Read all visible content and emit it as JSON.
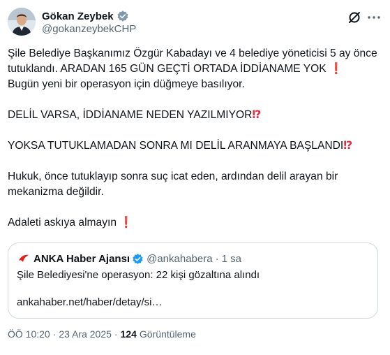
{
  "author": {
    "display_name": "Gökan Zeybek",
    "handle": "@gokanzeybekCHP",
    "verified_color": "#829aab"
  },
  "icons": {
    "grok": "grok-icon",
    "more": "more-options-icon"
  },
  "tweet": {
    "paragraphs": [
      "Şile Belediye Başkanımız Özgür Kabadayı ve 4 belediye yöneticisi 5 ay önce tutuklandı. ARADAN 165 GÜN GEÇTİ ORTADA İDDİANAME YOK",
      "Bugün yeni bir operasyon için düğmeye basılıyor.",
      "DELİL VARSA, İDDİANAME NEDEN YAZILMIYOR",
      "YOKSA TUTUKLAMADAN SONRA MI DELİL ARANMAYA BAŞLANDI",
      "Hukuk, önce tutuklayıp sonra suç icat eden, ardından delil arayan bir mekanizma değildir.",
      "Adaleti askıya almayın"
    ],
    "emoji_exclamation": "❗",
    "emoji_interrobang": "⁉"
  },
  "quote": {
    "name": "ANKA Haber Ajansı",
    "handle": "@ankahabera",
    "dot": "·",
    "time": "1 sa",
    "text": "Şile Belediyesi'ne operasyon: 22 kişi gözaltına alındı",
    "link": "ankahaber.net/haber/detay/si…",
    "verified_color": "#1d9bf0",
    "logo_color": "#e2231a"
  },
  "meta": {
    "time": "ÖÖ 10:20",
    "sep": "·",
    "date": "23 Ara 2025",
    "views_count": "124",
    "views_label": "Görüntüleme"
  }
}
